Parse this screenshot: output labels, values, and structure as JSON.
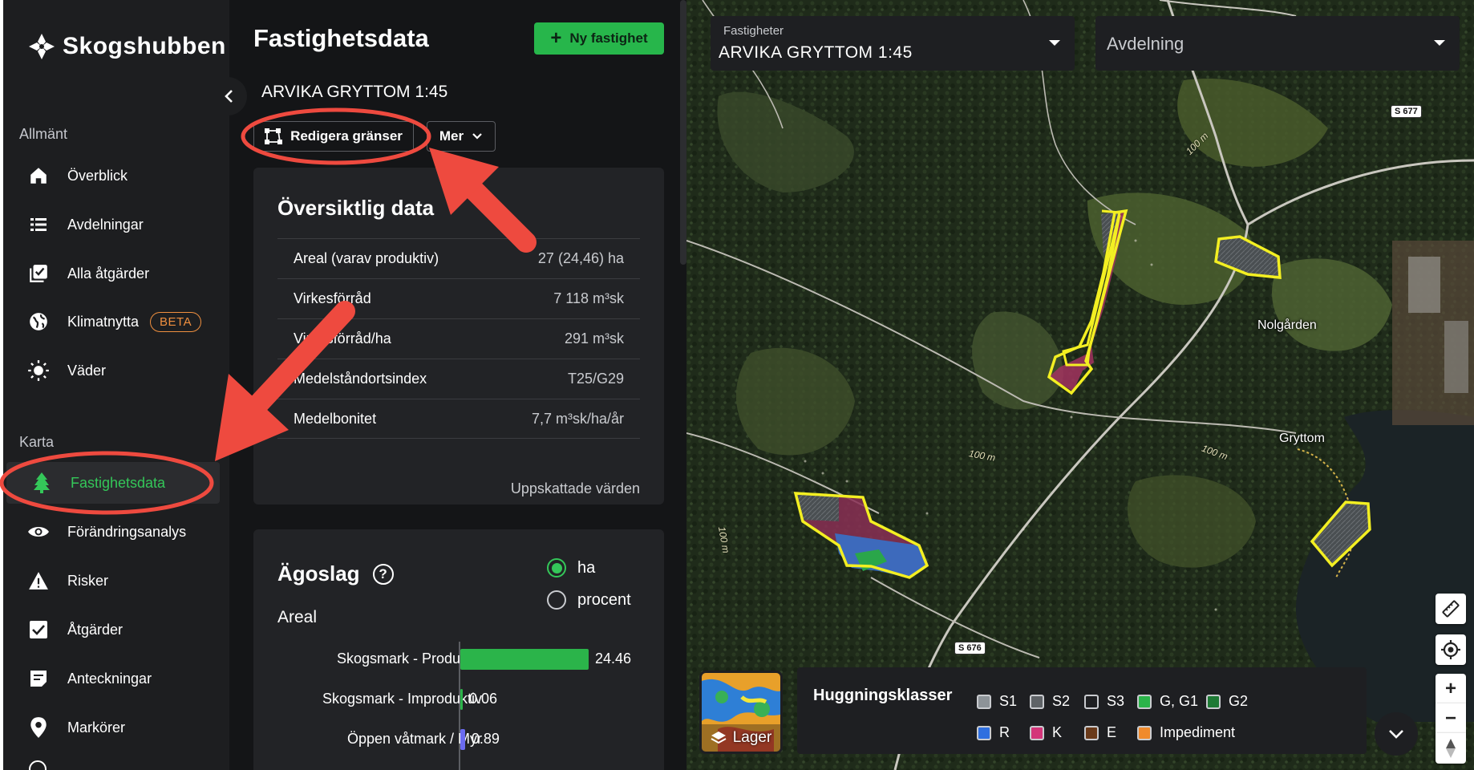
{
  "app": {
    "name": "Skogshubben"
  },
  "sidebar": {
    "sections": [
      {
        "title": "Allmänt"
      },
      {
        "title": "Karta"
      }
    ],
    "items": [
      {
        "label": "Överblick",
        "icon": "home-icon"
      },
      {
        "label": "Avdelningar",
        "icon": "list-icon"
      },
      {
        "label": "Alla åtgärder",
        "icon": "checklist-icon"
      },
      {
        "label": "Klimatnytta",
        "icon": "globe-icon",
        "badge": "BETA"
      },
      {
        "label": "Väder",
        "icon": "sun-icon"
      },
      {
        "label": "Fastighetsdata",
        "icon": "tree-icon",
        "active": true
      },
      {
        "label": "Förändringsanalys",
        "icon": "eye-icon"
      },
      {
        "label": "Risker",
        "icon": "warning-icon"
      },
      {
        "label": "Åtgärder",
        "icon": "checkbox-icon"
      },
      {
        "label": "Anteckningar",
        "icon": "notes-icon"
      },
      {
        "label": "Markörer",
        "icon": "pin-icon"
      }
    ]
  },
  "panel": {
    "title": "Fastighetsdata",
    "new_button": "Ny fastighet",
    "property_name": "ARVIKA GRYTTOM 1:45",
    "edit_button": "Redigera gränser",
    "more_button": "Mer",
    "overview": {
      "title": "Översiktlig data",
      "rows": [
        {
          "label": "Areal (varav produktiv)",
          "value": "27 (24,46) ha"
        },
        {
          "label": "Virkesförråd",
          "value": "7 118 m³sk"
        },
        {
          "label": "Virkesförråd/ha",
          "value": "291 m³sk"
        },
        {
          "label": "Medelståndortsindex",
          "value": "T25/G29"
        },
        {
          "label": "Medelbonitet",
          "value": "7,7 m³sk/ha/år"
        }
      ],
      "footnote": "Uppskattade värden"
    },
    "land_use": {
      "title": "Ägoslag",
      "help_icon": "help-circle-icon",
      "subtitle": "Areal",
      "unit_options": [
        {
          "label": "ha",
          "selected": true
        },
        {
          "label": "procent",
          "selected": false
        }
      ],
      "bars": [
        {
          "label": "Skogsmark - Produktiv",
          "value": "24.46",
          "color": "#2bb44a",
          "fraction": 0.905
        },
        {
          "label": "Skogsmark - Improduktiv",
          "value": "0.06",
          "color": "#2bb44a",
          "fraction": 0.002
        },
        {
          "label": "Öppen våtmark / Myr",
          "value": "0.89",
          "color": "#6b6bf0",
          "fraction": 0.033
        }
      ]
    }
  },
  "map": {
    "property_select": {
      "label": "Fastigheter",
      "value": "ARVIKA GRYTTOM 1:45"
    },
    "division_select": {
      "placeholder": "Avdelning"
    },
    "place_labels": [
      "Nolgården",
      "Gryttom"
    ],
    "road_tags": [
      "S 677",
      "S 676"
    ],
    "contour_labels": [
      "100 m",
      "100 m",
      "100 m",
      "100 m"
    ],
    "layers_button": "Lager",
    "legend": {
      "title": "Huggningsklasser",
      "items": [
        {
          "label": "S1",
          "color": "#8d9398"
        },
        {
          "label": "S2",
          "color": "#5f6367"
        },
        {
          "label": "S3",
          "color": "transparent"
        },
        {
          "label": "G, G1",
          "color": "#2bb44a"
        },
        {
          "label": "G2",
          "color": "#1e7a35"
        },
        {
          "label": "R",
          "color": "#2f6fe0"
        },
        {
          "label": "K",
          "color": "#d4357a"
        },
        {
          "label": "E",
          "color": "#6a3a1a"
        },
        {
          "label": "Impediment",
          "color": "#f08a2c"
        }
      ]
    }
  },
  "colors": {
    "sidebar_bg": "#1d1e20",
    "panel_bg": "#141517",
    "card_bg": "#222326",
    "accent": "#34c759",
    "primary_button": "#27b64b",
    "beta_badge": "#ef8f3f",
    "annotation": "#ee4a3f",
    "property_outline": "#f3ef22"
  }
}
